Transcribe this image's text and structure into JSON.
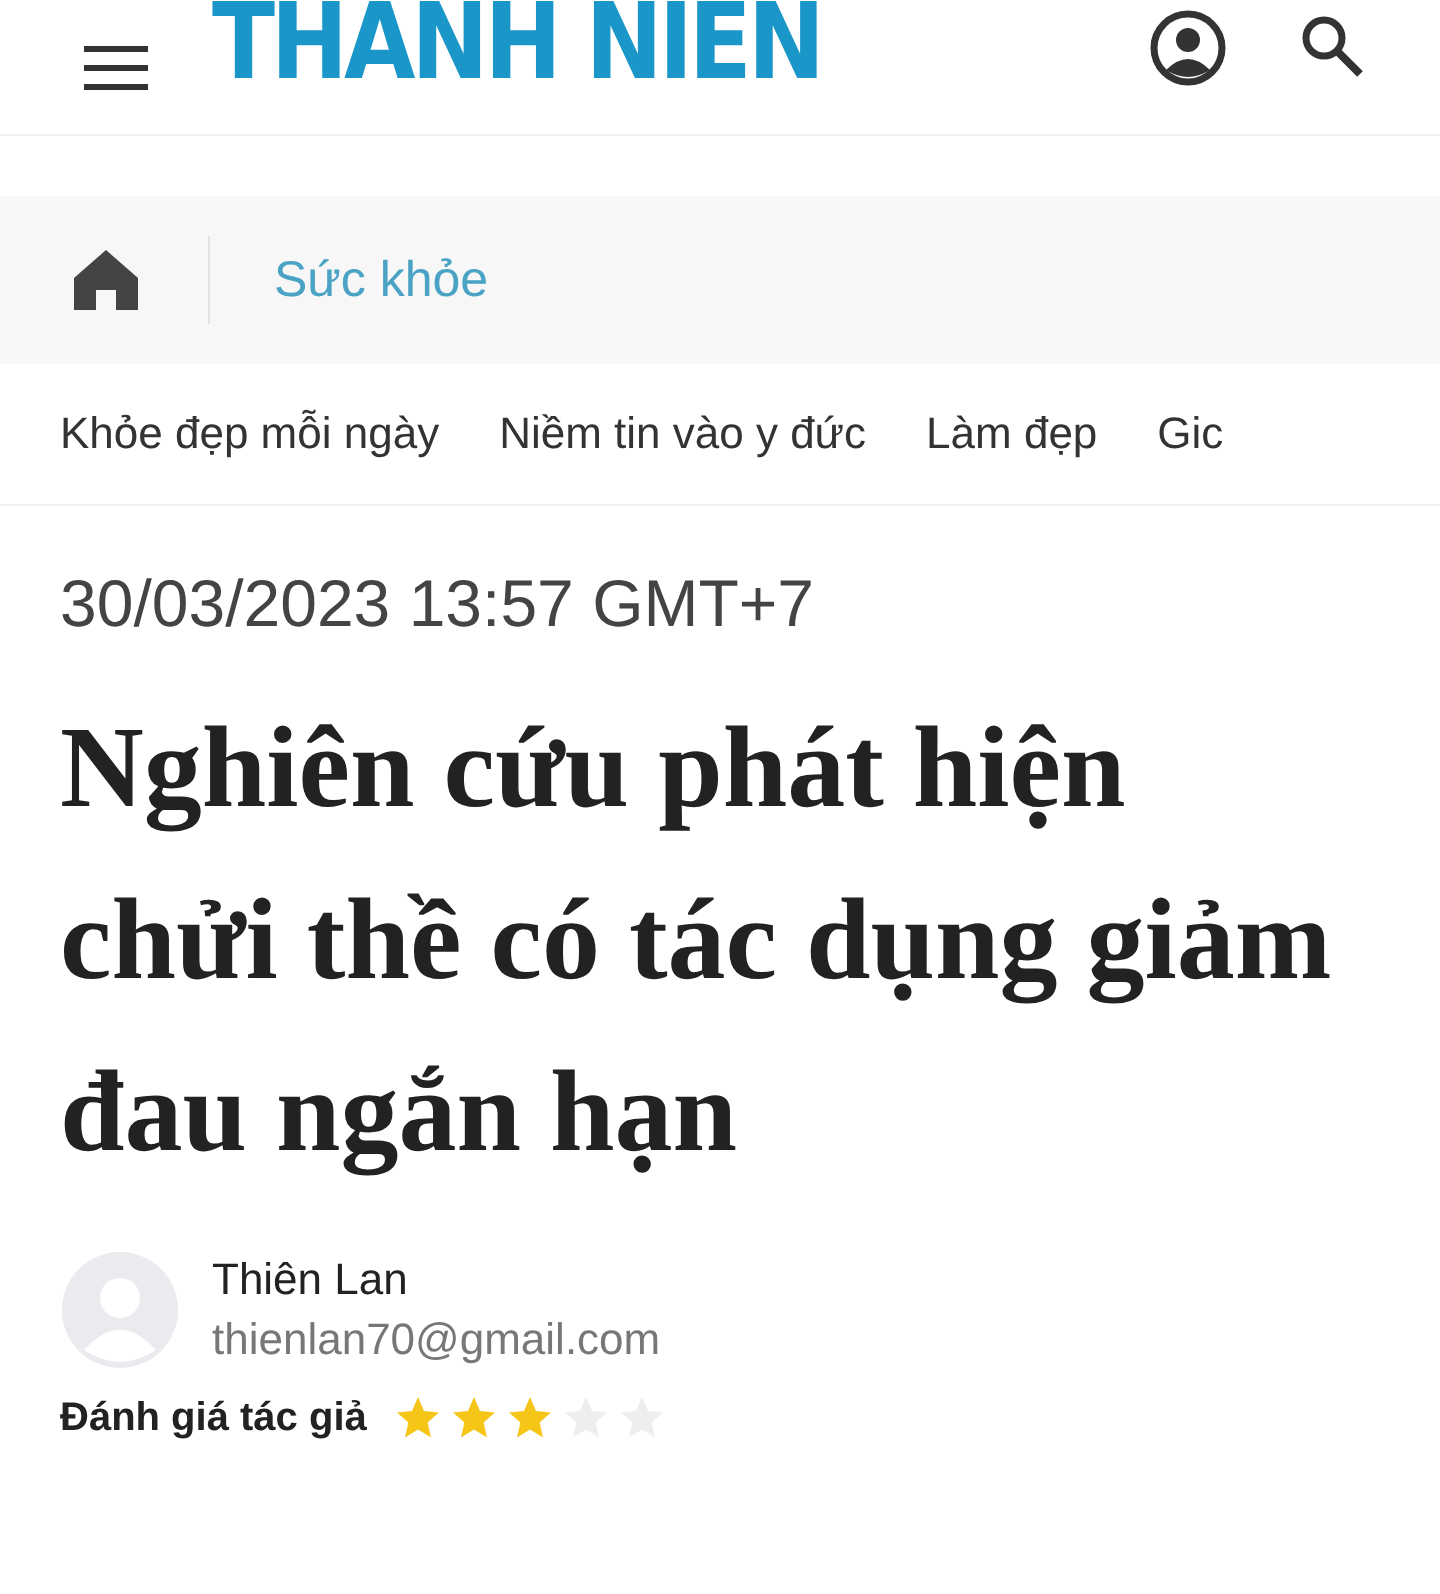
{
  "header": {
    "logo": "THANH NIEN"
  },
  "breadcrumb": {
    "section": "Sức khỏe"
  },
  "categories": [
    {
      "label": "Khỏe đẹp mỗi ngày"
    },
    {
      "label": "Niềm tin vào y đức"
    },
    {
      "label": "Làm đẹp"
    },
    {
      "label": "Gic"
    }
  ],
  "article": {
    "date": "30/03/2023 13:57 GMT+7",
    "title": "Nghiên cứu phát hiện chửi thề có tác dụng giảm đau ngắn hạn",
    "author": {
      "name": "Thiên Lan",
      "email": "thienlan70@gmail.com"
    },
    "rating": {
      "label": "Đánh giá tác giả",
      "stars": 3
    }
  }
}
